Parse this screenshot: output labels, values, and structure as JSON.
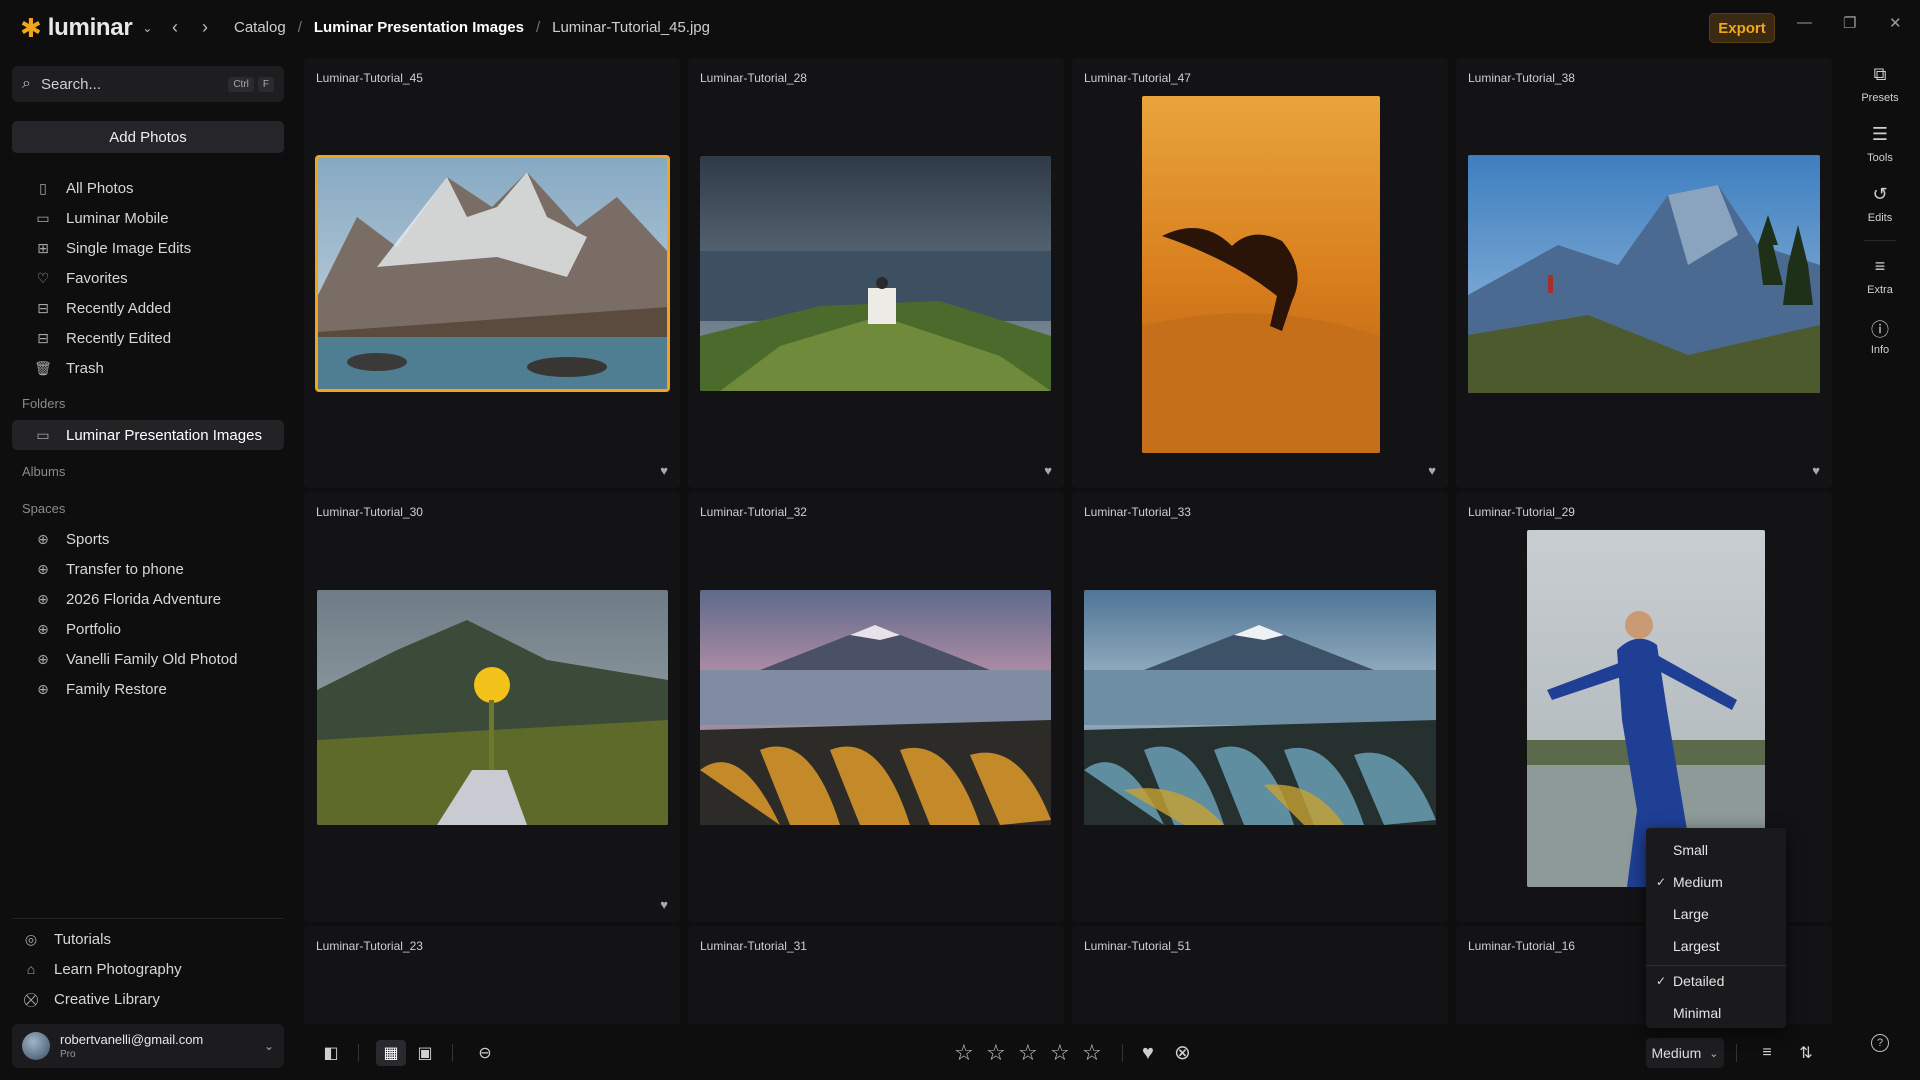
{
  "app": {
    "name": "luminar"
  },
  "header": {
    "breadcrumbs": [
      "Catalog",
      "Luminar Presentation Images",
      "Luminar-Tutorial_45.jpg"
    ],
    "export_label": "Export"
  },
  "sidebar": {
    "search_placeholder": "Search...",
    "search_kbd": [
      "Ctrl",
      "F"
    ],
    "add_photos_label": "Add Photos",
    "library": [
      {
        "label": "All Photos",
        "icon": "photos-icon"
      },
      {
        "label": "Luminar Mobile",
        "icon": "mobile-icon"
      },
      {
        "label": "Single Image Edits",
        "icon": "grid-icon"
      },
      {
        "label": "Favorites",
        "icon": "heart-icon"
      },
      {
        "label": "Recently Added",
        "icon": "recent-added-icon"
      },
      {
        "label": "Recently Edited",
        "icon": "recent-edited-icon"
      },
      {
        "label": "Trash",
        "icon": "trash-icon"
      }
    ],
    "folders_label": "Folders",
    "folders": [
      {
        "label": "Luminar Presentation Images",
        "icon": "folder-icon",
        "active": true
      }
    ],
    "albums_label": "Albums",
    "spaces_label": "Spaces",
    "spaces": [
      {
        "label": "Sports",
        "icon": "globe-icon"
      },
      {
        "label": "Transfer to phone",
        "icon": "globe-icon"
      },
      {
        "label": "2026 Florida Adventure",
        "icon": "globe-icon"
      },
      {
        "label": "Portfolio",
        "icon": "globe-icon"
      },
      {
        "label": "Vanelli Family Old Photod",
        "icon": "globe-icon"
      },
      {
        "label": "Family Restore",
        "icon": "globe-icon"
      }
    ],
    "bottom_links": [
      {
        "label": "Tutorials",
        "icon": "tutorials-icon"
      },
      {
        "label": "Learn Photography",
        "icon": "graduation-icon"
      },
      {
        "label": "Creative Library",
        "icon": "cart-icon"
      }
    ],
    "account": {
      "email": "robertvanelli@gmail.com",
      "plan": "Pro"
    }
  },
  "grid": {
    "items": [
      {
        "name": "Luminar-Tutorial_45",
        "scene": "mountain-lake",
        "selected": true,
        "favorite_icon": true
      },
      {
        "name": "Luminar-Tutorial_28",
        "scene": "coast-person",
        "favorite_icon": true
      },
      {
        "name": "Luminar-Tutorial_47",
        "scene": "desert-flip",
        "favorite_icon": true
      },
      {
        "name": "Luminar-Tutorial_38",
        "scene": "valley-dome",
        "favorite_icon": true
      },
      {
        "name": "Luminar-Tutorial_30",
        "scene": "hand-flowers",
        "favorite_icon": true
      },
      {
        "name": "Luminar-Tutorial_32",
        "scene": "fuji-dusk",
        "favorite_icon": false
      },
      {
        "name": "Luminar-Tutorial_33",
        "scene": "fuji-blue",
        "favorite_icon": false
      },
      {
        "name": "Luminar-Tutorial_29",
        "scene": "woman-blue-dress",
        "favorite_icon": false
      },
      {
        "name": "Luminar-Tutorial_23"
      },
      {
        "name": "Luminar-Tutorial_31"
      },
      {
        "name": "Luminar-Tutorial_51"
      },
      {
        "name": "Luminar-Tutorial_16"
      }
    ]
  },
  "rail": [
    {
      "label": "Presets",
      "icon": "presets-icon"
    },
    {
      "label": "Tools",
      "icon": "sliders-icon"
    },
    {
      "label": "Edits",
      "icon": "history-icon"
    },
    {
      "label": "Extra",
      "icon": "list-icon"
    },
    {
      "label": "Info",
      "icon": "info-icon"
    }
  ],
  "toolbar": {
    "view_modes": [
      "sidebar-toggle-icon",
      "grid-view-icon",
      "single-view-icon"
    ],
    "rating_stars": 5,
    "thumbnail_size": "Medium"
  },
  "size_menu": {
    "sizes": [
      {
        "label": "Small",
        "checked": false
      },
      {
        "label": "Medium",
        "checked": true
      },
      {
        "label": "Large",
        "checked": false
      },
      {
        "label": "Largest",
        "checked": false
      }
    ],
    "detail": [
      {
        "label": "Detailed",
        "checked": true
      },
      {
        "label": "Minimal",
        "checked": false
      }
    ]
  },
  "colors": {
    "accent": "#f2a51a",
    "background": "#0e0e0f"
  }
}
